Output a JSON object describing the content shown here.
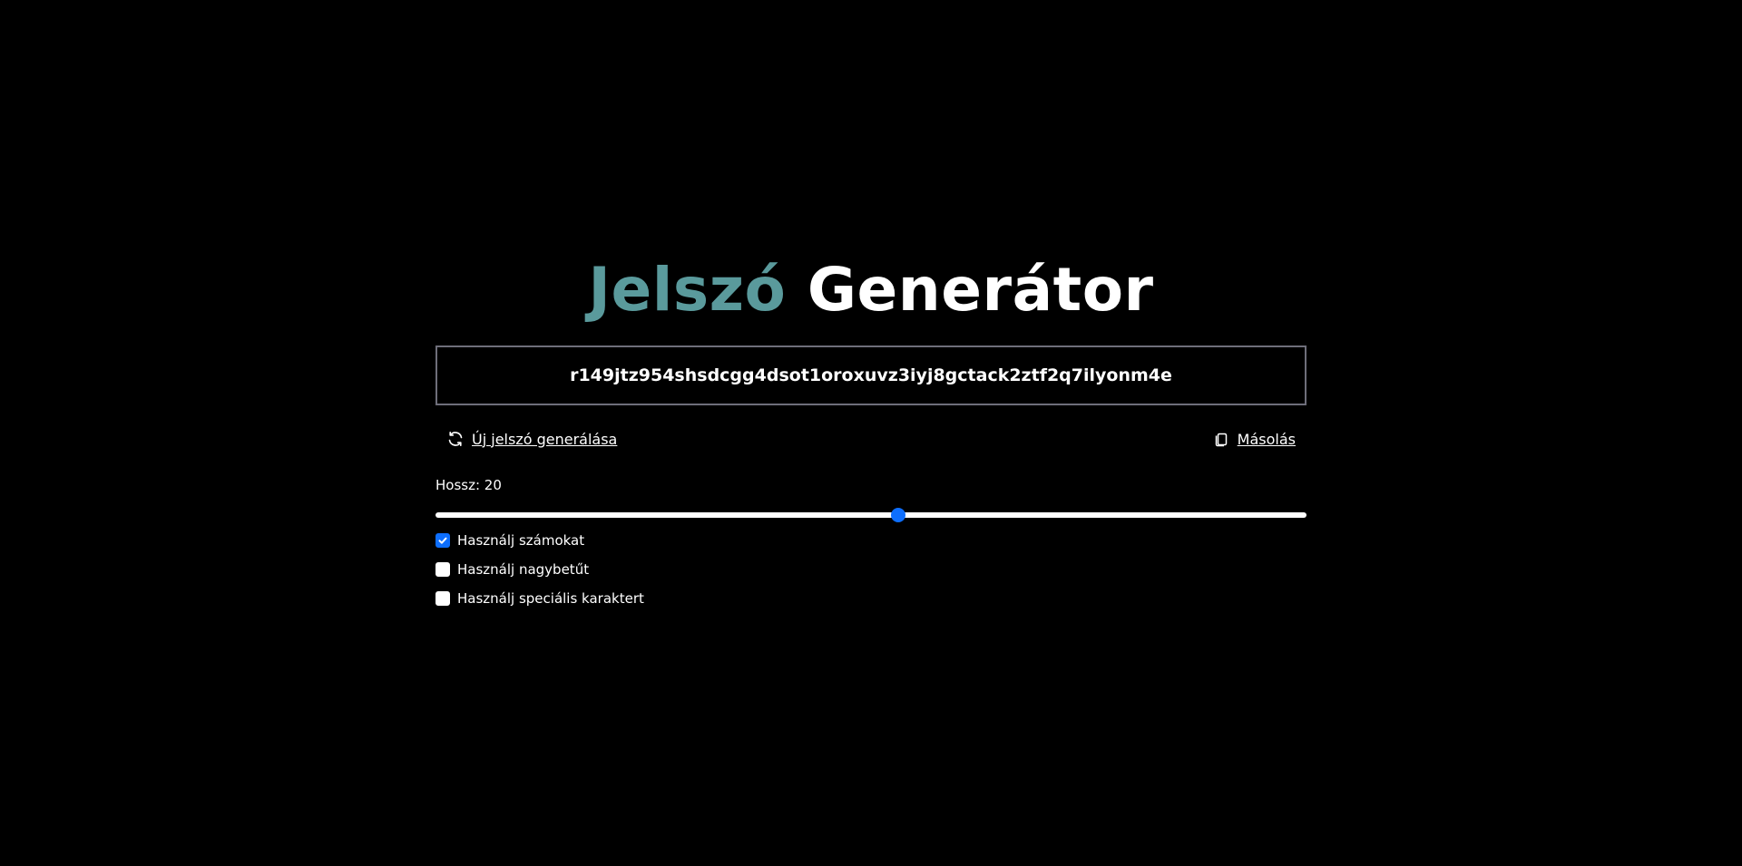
{
  "title": {
    "accent": "Jelszó",
    "rest": "Generátor"
  },
  "password": {
    "value": "r149jtz954shsdcgg4dsot1oroxuvz3iyj8gctack2ztf2q7ilyonm4e"
  },
  "actions": {
    "generate_label": "Új jelszó generálása",
    "generate_icon": "refresh-icon",
    "copy_label": "Másolás",
    "copy_icon": "copy-icon"
  },
  "length": {
    "label": "Hossz: 20",
    "value": 20,
    "slider_fraction": 0.531
  },
  "options": [
    {
      "label": "Használj számokat",
      "checked": true
    },
    {
      "label": "Használj nagybetűt",
      "checked": false
    },
    {
      "label": "Használj speciális karaktert",
      "checked": false
    }
  ],
  "colors": {
    "background": "#000000",
    "accent": "#5a9a9c",
    "slider_thumb": "#0d6efd",
    "checkbox_checked": "#0d6efd"
  }
}
